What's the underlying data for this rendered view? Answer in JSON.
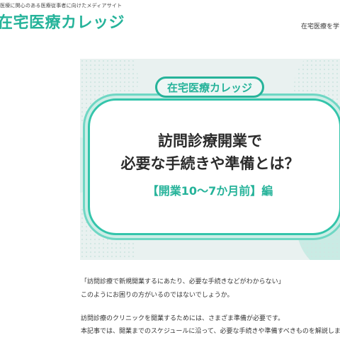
{
  "header": {
    "tagline": "医療に関心のある医療従事者に向けたメディアサイト",
    "logo": "在宅医療カレッジ",
    "nav_link": "在宅医療を学"
  },
  "hero": {
    "badge": "在宅医療カレッジ",
    "title_line1": "訪問診療開業で",
    "title_line2": "必要な手続きや準備とは？",
    "subtitle": "【開業10〜7か月前】編"
  },
  "article": {
    "paragraphs": [
      "「訪問診療で新規開業するにあたり、必要な手続きなどがわからない」",
      "このようにお困りの方がいるのではないでしょうか。",
      "訪問診療のクリニックを開業するためには、さまざま準備が必要です。",
      "本記事では、開業までのスケジュールに沿って、必要な手続きや準備すべきものを解説します。"
    ]
  },
  "colors": {
    "brand": "#26b39a",
    "hero_bg": "#e9f1f0"
  }
}
